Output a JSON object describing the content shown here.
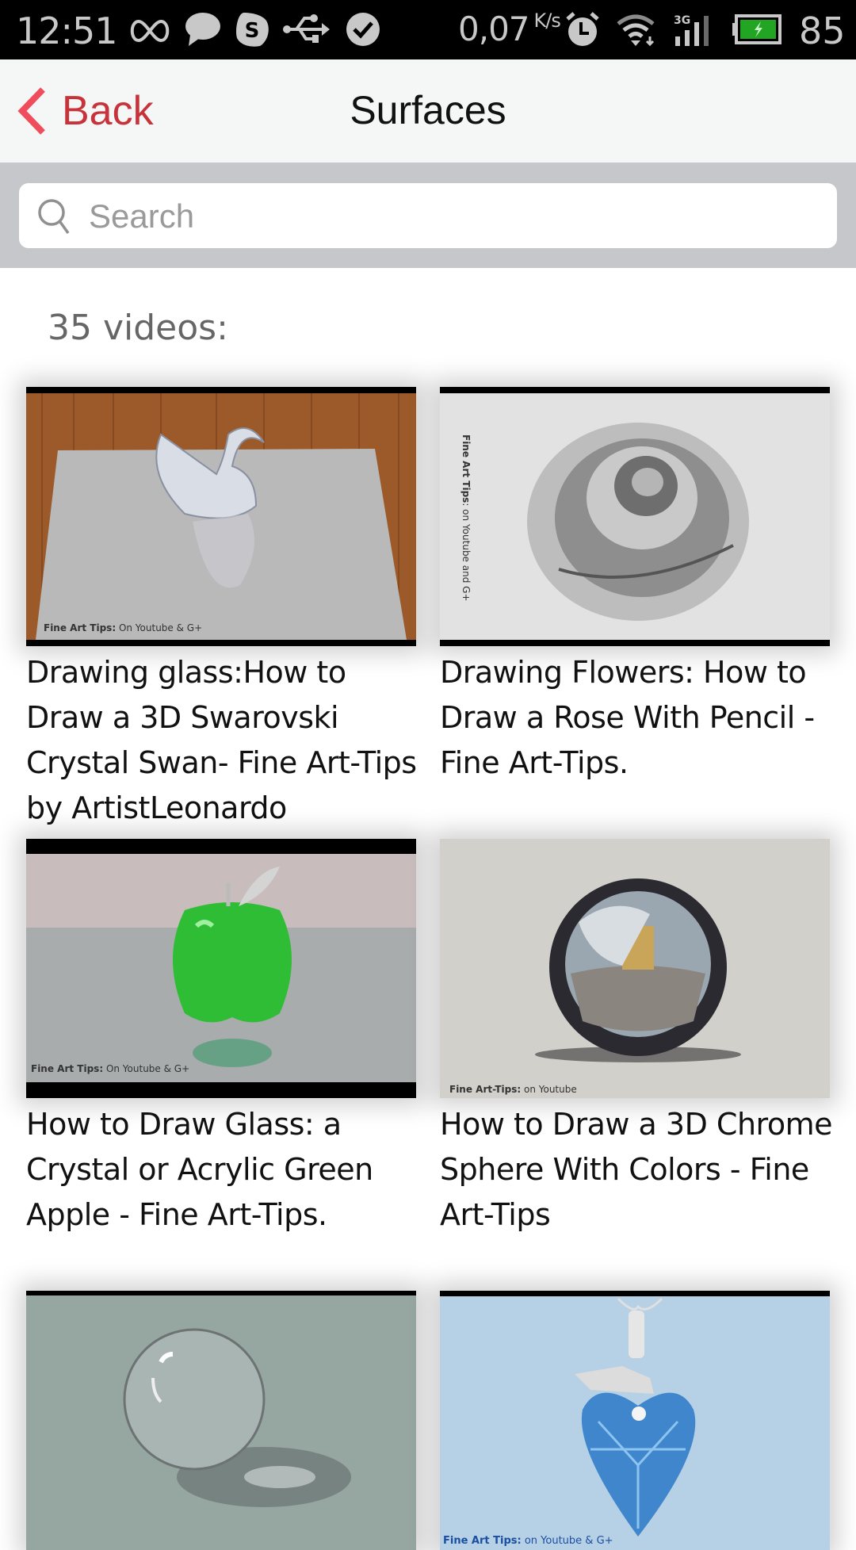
{
  "status_bar": {
    "time": "12:51",
    "net_speed": "0,07",
    "net_speed_unit": "K/s",
    "battery_percent": "85",
    "network_type": "3G",
    "icons": [
      "infinity-icon",
      "chat-bubble-icon",
      "skype-icon",
      "usb-icon",
      "check-circle-icon",
      "alarm-clock-icon",
      "wifi-icon",
      "signal-icon",
      "battery-charging-icon"
    ],
    "battery_color": "#22a522"
  },
  "nav": {
    "back_label": "Back",
    "title": "Surfaces",
    "accent_color": "#c8323a"
  },
  "search": {
    "placeholder": "Search",
    "value": ""
  },
  "list": {
    "count_label": "35 videos:",
    "videos": [
      {
        "title": "Drawing glass:How to Draw a 3D Swarovski Crystal Swan- Fine Art-Tips by ArtistLeonardo",
        "watermark_bold": "Fine Art Tips:",
        "watermark": " On Youtube & G+",
        "thumbnail": "crystal-swan"
      },
      {
        "title": "Drawing Flowers: How to Draw a Rose With Pencil - Fine Art-Tips.",
        "watermark_bold": "Fine Art Tips",
        "watermark": ": on Youtube and G+",
        "thumbnail": "pencil-rose"
      },
      {
        "title": "How to Draw Glass: a Crystal or Acrylic Green Apple - Fine Art-Tips.",
        "watermark_bold": "Fine Art Tips:",
        "watermark": " On Youtube & G+",
        "thumbnail": "green-glass-apple"
      },
      {
        "title": "How to Draw a 3D Chrome Sphere With Colors - Fine Art-Tips",
        "watermark_bold": "Fine Art-Tips:",
        "watermark": " on Youtube",
        "thumbnail": "chrome-sphere"
      },
      {
        "title": "",
        "watermark_bold": "",
        "watermark": "",
        "thumbnail": "glass-sphere"
      },
      {
        "title": "",
        "watermark_bold": "Fine Art Tips:",
        "watermark": " on Youtube & G+",
        "thumbnail": "blue-heart-pendant"
      }
    ]
  }
}
